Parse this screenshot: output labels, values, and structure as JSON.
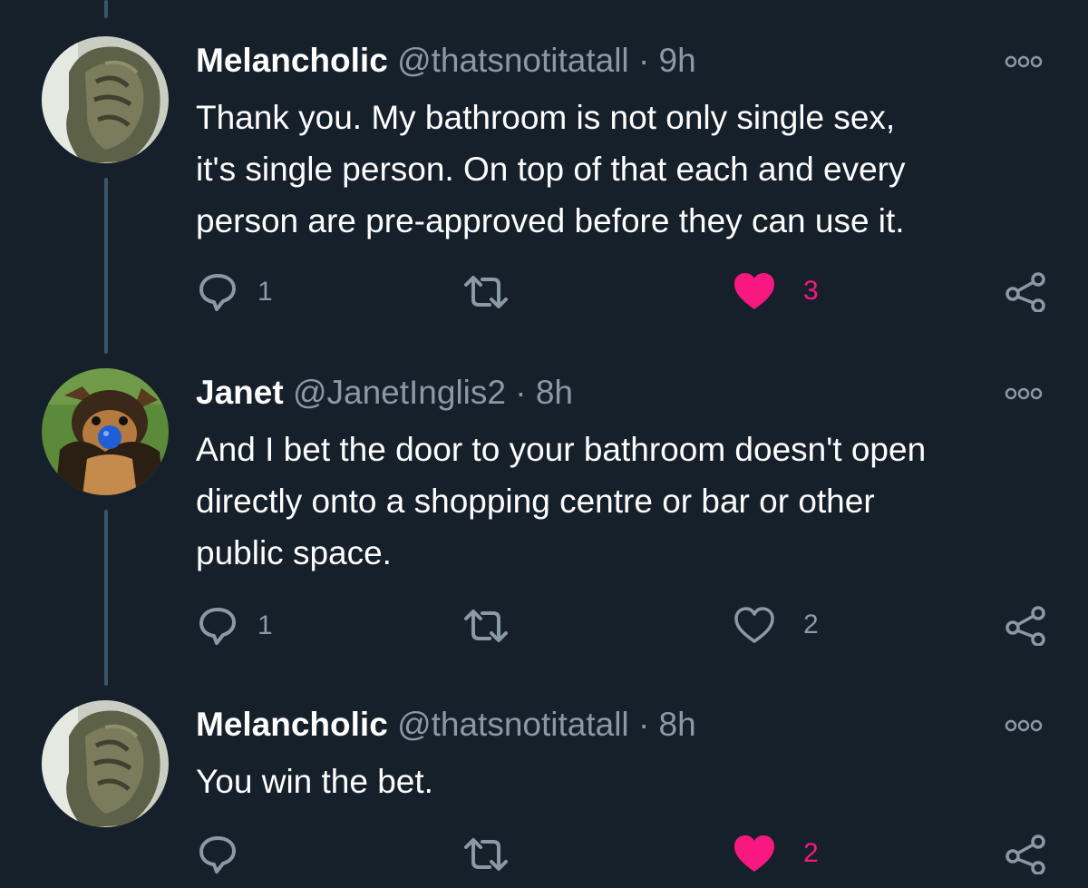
{
  "colors": {
    "background": "#15202b",
    "text": "#ffffff",
    "secondary_text": "#8b98a5",
    "like_active": "#f91880",
    "thread_line": "#3d5466"
  },
  "tweets": [
    {
      "name": "Melancholic",
      "handle": "@thatsnotitatall",
      "separator": "·",
      "time": "9h",
      "avatar": "stone-carving-avatar",
      "text_lines": [
        "Thank you. My bathroom is not only single sex,",
        "it's single person. On top of that each and every",
        "person are pre-approved before they can use it."
      ],
      "reply_count": "1",
      "retweet_count": "",
      "like_count": "3",
      "liked": true
    },
    {
      "name": "Janet",
      "handle": "@JanetInglis2",
      "separator": "·",
      "time": "8h",
      "avatar": "dog-with-ball-avatar",
      "text_lines": [
        "And I bet the door to your bathroom doesn't open",
        "directly onto a shopping centre or bar or other",
        "public space."
      ],
      "reply_count": "1",
      "retweet_count": "",
      "like_count": "2",
      "liked": false
    },
    {
      "name": "Melancholic",
      "handle": "@thatsnotitatall",
      "separator": "·",
      "time": "8h",
      "avatar": "stone-carving-avatar",
      "text_lines": [
        "You win the bet."
      ],
      "reply_count": "",
      "retweet_count": "",
      "like_count": "2",
      "liked": true
    }
  ]
}
